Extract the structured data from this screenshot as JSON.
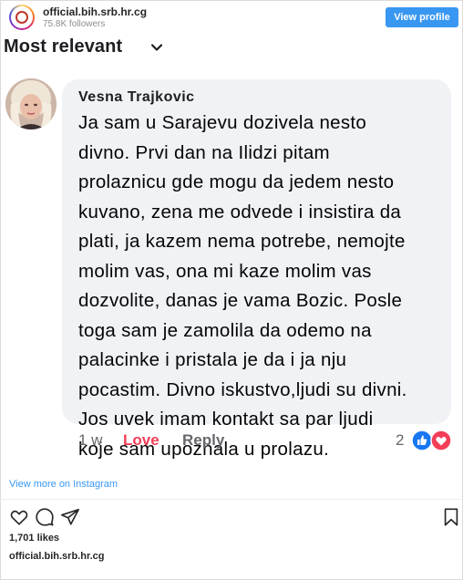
{
  "header": {
    "account_name": "official.bih.srb.hr.cg",
    "followers": "75.8K followers",
    "view_profile_label": "View profile"
  },
  "sort": {
    "label": "Most relevant",
    "chevron_icon": "chevron-down-icon"
  },
  "comment": {
    "author": "Vesna Trajkovic",
    "text_lines": [
      "Ja sam u Sarajevu dozivela nesto",
      "divno. Prvi dan na Ilidzi pitam",
      "prolaznicu gde mogu da jedem nesto",
      "kuvano, zena me odvede i insistira da",
      "plati, ja kazem nema potrebe, nemojte",
      "molim vas, ona mi kaze molim vas",
      "dozvolite, danas je vama Bozic. Posle",
      "toga sam je zamolila da odemo na",
      "palacinke i pristala je da i ja nju",
      "pocastim. Divno iskustvo,ljudi su divni.",
      "Jos uvek imam kontakt sa par ljudi",
      "koje sam upoznala u prolazu."
    ],
    "time": "1 w",
    "love_label": "Love",
    "reply_label": "Reply",
    "reaction_count": "2",
    "reaction_icons": [
      "like-icon",
      "heart-icon"
    ],
    "colors": {
      "love": "#f33e58",
      "like": "#1877f2",
      "heart": "#f33e58",
      "bubble": "#f0f2f5"
    }
  },
  "instagram": {
    "view_more_label": "View more on Instagram",
    "likes": "1,701 likes",
    "account_name": "official.bih.srb.hr.cg",
    "icons": [
      "heart-outline-icon",
      "comment-icon",
      "share-icon",
      "bookmark-icon"
    ],
    "accent": "#3897f0"
  }
}
